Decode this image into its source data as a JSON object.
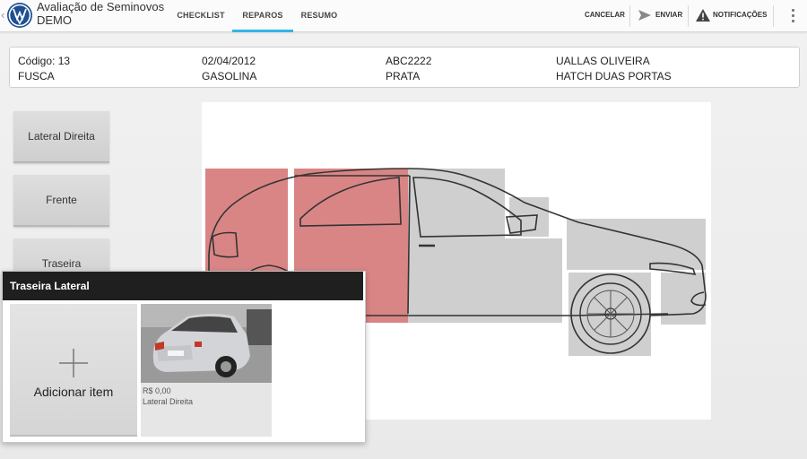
{
  "app": {
    "title": "Avaliação de Seminovos",
    "subtitle": "DEMO",
    "logo_icon": "vw-logo-icon"
  },
  "tabs": [
    {
      "label": "CHECKLIST",
      "active": false
    },
    {
      "label": "REPAROS",
      "active": true
    },
    {
      "label": "RESUMO",
      "active": false
    }
  ],
  "actions": {
    "cancel_label": "CANCELAR",
    "send_label": "ENVIAR",
    "notifications_label": "NOTIFICAÇÕES"
  },
  "vehicle": {
    "code": "Código: 13",
    "date": "02/04/2012",
    "plate": "ABC2222",
    "owner": "UALLAS OLIVEIRA",
    "model": "FUSCA",
    "fuel": "GASOLINA",
    "color": "PRATA",
    "body": "HATCH DUAS PORTAS"
  },
  "views": [
    "Lateral Direita",
    "Frente",
    "Traseira"
  ],
  "popup": {
    "title": "Traseira Lateral",
    "add_label": "Adicionar item",
    "items": [
      {
        "price": "R$ 0,00",
        "description": "Lateral Direita"
      }
    ]
  },
  "colors": {
    "accent": "#33b5e5",
    "damage_zone": "#d98585",
    "zone": "#c9c9c9"
  }
}
